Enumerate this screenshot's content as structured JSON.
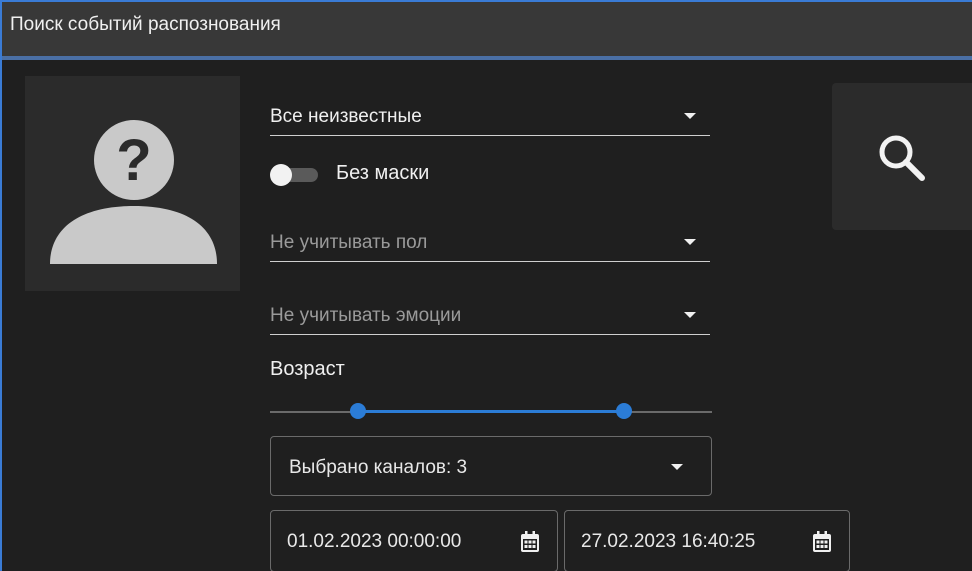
{
  "window": {
    "title": "Поиск событий распознования"
  },
  "avatar": {
    "icon": "unknown-person-icon"
  },
  "filters": {
    "person_select": {
      "value": "Все неизвестные"
    },
    "mask_toggle": {
      "label": "Без маски",
      "on": false
    },
    "gender_select": {
      "value": "Не учитывать пол"
    },
    "emotion_select": {
      "value": "Не учитывать эмоции"
    },
    "age": {
      "label": "Возраст",
      "range_start_fraction": 0.2,
      "range_end_fraction": 0.8
    },
    "channels_select": {
      "value": "Выбрано каналов: 3"
    },
    "date_from": {
      "value": "01.02.2023 00:00:00",
      "icon": "calendar-icon"
    },
    "date_to": {
      "value": "27.02.2023 16:40:25",
      "icon": "calendar-icon"
    }
  },
  "search_button": {
    "icon": "search-icon"
  },
  "colors": {
    "accent": "#2b7cd6",
    "background": "#1f1f1f",
    "titlebar": "#383838",
    "panel": "#2b2b2b"
  }
}
